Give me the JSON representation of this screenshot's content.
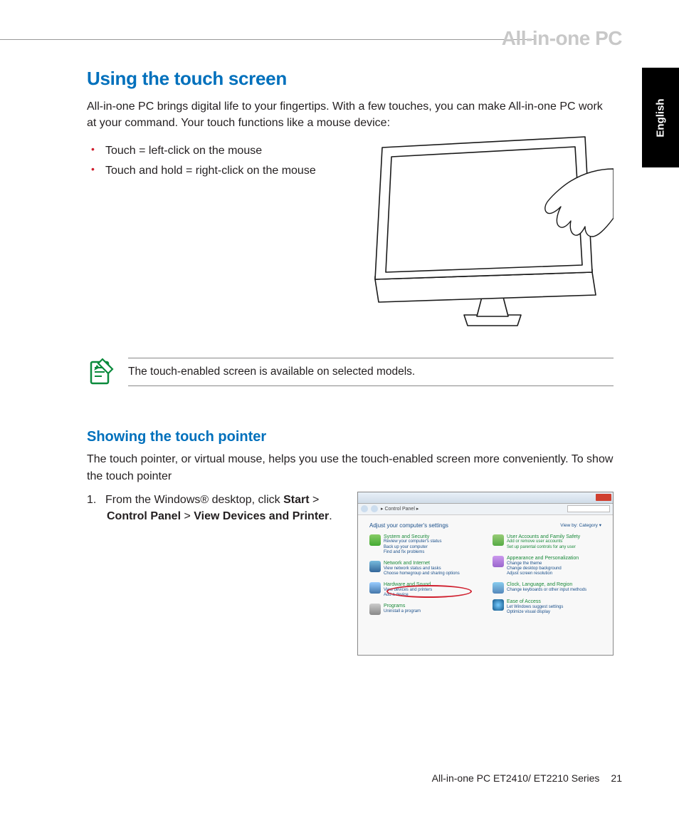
{
  "header": {
    "series_label": "All-in-one PC",
    "language_tab": "English"
  },
  "section": {
    "title": "Using the touch screen",
    "intro": "All-in-one PC brings digital life to your fingertips. With a few touches, you can make All-in-one PC work at your command. Your touch functions like a mouse device:",
    "bullets": [
      "Touch = left-click on the mouse",
      "Touch and hold = right-click on the mouse"
    ],
    "note": "The touch-enabled screen is available on selected models."
  },
  "subsection": {
    "title": "Showing the touch pointer",
    "intro": "The touch pointer, or virtual mouse, helps you use the touch-enabled screen more conveniently. To show the touch pointer",
    "step_number": "1.",
    "step_prefix": "From the Windows® desktop, click ",
    "step_bold1": "Start",
    "step_sep1": " > ",
    "step_bold2": "Control Panel",
    "step_sep2": " > ",
    "step_bold3": "View Devices and Printer",
    "step_suffix": "."
  },
  "screenshot": {
    "breadcrumb": "Control Panel",
    "heading": "Adjust your computer's settings",
    "view_label": "View by:   Category ▾",
    "left_items": [
      {
        "title": "System and Security",
        "subs": [
          "Review your computer's status",
          "Back up your computer",
          "Find and fix problems"
        ]
      },
      {
        "title": "Network and Internet",
        "subs": [
          "View network status and tasks",
          "Choose homegroup and sharing options"
        ]
      },
      {
        "title": "Hardware and Sound",
        "subs": [
          "View devices and printers",
          "Add a device"
        ]
      },
      {
        "title": "Programs",
        "subs": [
          "Uninstall a program"
        ]
      }
    ],
    "right_items": [
      {
        "title": "User Accounts and Family Safety",
        "subs": [
          "Add or remove user accounts",
          "Set up parental controls for any user"
        ]
      },
      {
        "title": "Appearance and Personalization",
        "subs": [
          "Change the theme",
          "Change desktop background",
          "Adjust screen resolution"
        ]
      },
      {
        "title": "Clock, Language, and Region",
        "subs": [
          "Change keyboards or other input methods"
        ]
      },
      {
        "title": "Ease of Access",
        "subs": [
          "Let Windows suggest settings",
          "Optimize visual display"
        ]
      }
    ]
  },
  "footer": {
    "product": "All-in-one PC ET2410/ ET2210 Series",
    "page": "21"
  }
}
